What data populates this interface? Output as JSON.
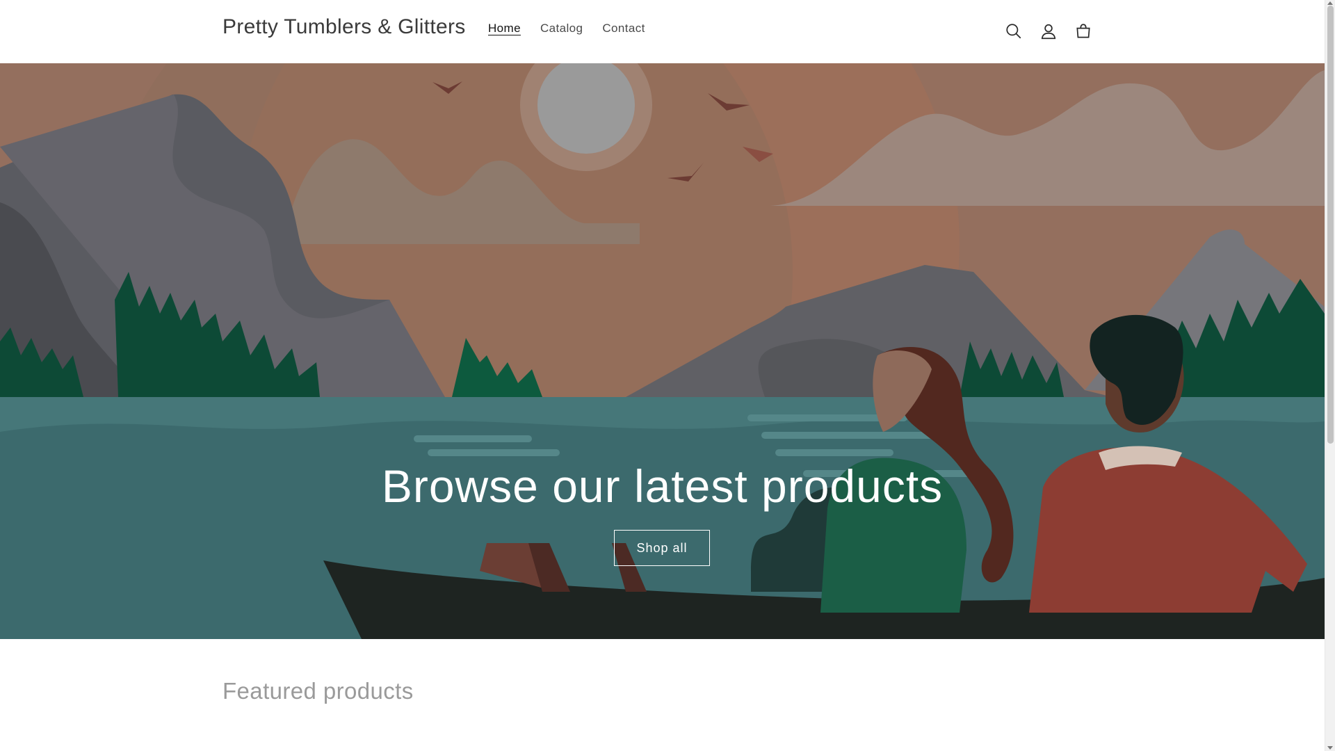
{
  "header": {
    "logo": "Pretty Tumblers & Glitters",
    "nav": [
      {
        "label": "Home",
        "active": true
      },
      {
        "label": "Catalog",
        "active": false
      },
      {
        "label": "Contact",
        "active": false
      }
    ],
    "icons": [
      "search-icon",
      "account-icon",
      "cart-icon"
    ]
  },
  "hero": {
    "title": "Browse our latest products",
    "button_label": "Shop all"
  },
  "featured": {
    "title": "Featured products"
  },
  "colors": {
    "sky": "#8C6E60",
    "water": "#3D6B6E",
    "trees": "#0D4A36",
    "boat": "#1E2421"
  }
}
